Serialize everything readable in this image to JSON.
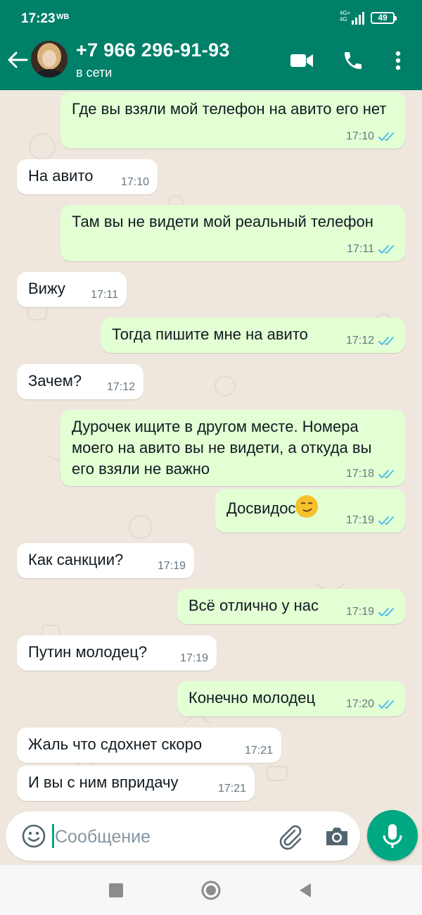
{
  "status_bar": {
    "time": "17:23",
    "extra": "WB",
    "network_top": "4G+",
    "network_bottom": "4G",
    "battery": "49"
  },
  "header": {
    "contact_name": "+7 966 296-91-93",
    "contact_status": "в сети"
  },
  "messages": [
    {
      "direction": "outgoing",
      "text": "Где вы взяли мой телефон на авито его нет",
      "time": "17:10",
      "read": true
    },
    {
      "direction": "incoming",
      "text": "На авито",
      "time": "17:10"
    },
    {
      "direction": "outgoing",
      "text": "Там вы не видети мой реальный телефон",
      "time": "17:11",
      "read": true
    },
    {
      "direction": "incoming",
      "text": "Вижу",
      "time": "17:11"
    },
    {
      "direction": "outgoing",
      "text": "Тогда пишите мне на авито",
      "time": "17:12",
      "read": true
    },
    {
      "direction": "incoming",
      "text": "Зачем?",
      "time": "17:12"
    },
    {
      "direction": "outgoing",
      "text": "Дурочек ищите в другом месте. Номера моего на авито вы не видети, а откуда вы его взяли не важно",
      "time": "17:18",
      "read": true
    },
    {
      "direction": "outgoing",
      "text": "Досвидос",
      "emoji": "smirking-face",
      "time": "17:19",
      "read": true
    },
    {
      "direction": "incoming",
      "text": "Как санкции?",
      "time": "17:19"
    },
    {
      "direction": "outgoing",
      "text": "Всё отлично у нас",
      "time": "17:19",
      "read": true
    },
    {
      "direction": "incoming",
      "text": "Путин молодец?",
      "time": "17:19"
    },
    {
      "direction": "outgoing",
      "text": "Конечно молодец",
      "time": "17:20",
      "read": true
    },
    {
      "direction": "incoming",
      "text": "Жаль что сдохнет скоро",
      "time": "17:21"
    },
    {
      "direction": "incoming",
      "text": "И вы с ним впридачу",
      "time": "17:21"
    }
  ],
  "composer": {
    "placeholder": "Сообщение"
  },
  "colors": {
    "header": "#008069",
    "outgoing_bubble": "#e3ffd4",
    "incoming_bubble": "#ffffff",
    "read_ticks": "#53bdeb",
    "accent": "#00a884"
  },
  "icons": [
    "back-arrow-icon",
    "avatar",
    "video-call-icon",
    "phone-icon",
    "more-vert-icon",
    "emoji-icon",
    "attach-icon",
    "camera-icon",
    "mic-icon"
  ]
}
